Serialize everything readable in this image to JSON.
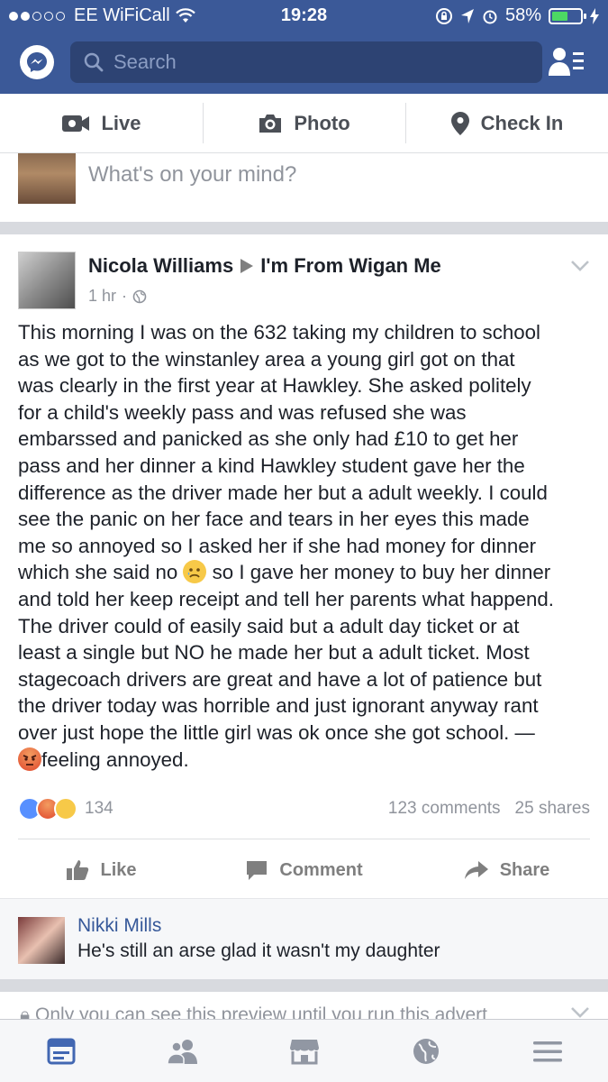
{
  "status_bar": {
    "carrier": "EE WiFiCall",
    "time": "19:28",
    "battery_percent": "58%",
    "battery_level": 0.58
  },
  "search": {
    "placeholder": "Search"
  },
  "composer": {
    "actions": [
      {
        "label": "Live",
        "icon": "video-camera-icon"
      },
      {
        "label": "Photo",
        "icon": "camera-icon"
      },
      {
        "label": "Check In",
        "icon": "location-pin-icon"
      }
    ],
    "placeholder": "What's on your mind?"
  },
  "post": {
    "author": "Nicola Williams",
    "group": "I'm From Wigan Me",
    "time": "1 hr",
    "privacy_icon": "globe-icon",
    "body_part1": "This morning I was on the 632 taking my children to school\nas we got to the winstanley  area a young girl got on that\nwas clearly in the first year at Hawkley. She asked politely\nfor a child's weekly pass and was refused she was\nembarssed and panicked as she only had £10 to get her\npass and her dinner a kind Hawkley student gave her the\ndifference as the driver made her but a adult weekly. I could\nsee the panic on her face and tears in her eyes this made\nme so annoyed so I asked her if she had money for dinner\nwhich she said no ",
    "body_part2": " so I gave her money to buy her dinner\nand told her keep receipt and tell her parents what happend.\nThe driver could of  easily said but a adult day ticket or at\nleast a single but NO he made her but a adult ticket. Most\nstagecoach drivers are great and have a lot of patience but\nthe driver today was horrible and just ignorant anyway rant\nover just hope the little girl was ok once she got school. —\n",
    "feeling": "feeling annoyed.",
    "reaction_count": "134",
    "comments_count": "123 comments",
    "shares_count": "25 shares",
    "actions": {
      "like": "Like",
      "comment": "Comment",
      "share": "Share"
    }
  },
  "comment": {
    "author": "Nikki Mills",
    "text": "He's still an arse glad it wasn't my daughter"
  },
  "next_item": {
    "text": "Only you can see this preview until you run this advert"
  },
  "tab_bar": {
    "tabs": [
      "news-feed-icon",
      "friends-icon",
      "marketplace-icon",
      "notifications-globe-icon",
      "menu-icon"
    ],
    "active_color": "#4267b2",
    "inactive_color": "#9197a3"
  },
  "colors": {
    "brand_blue": "#3b5998",
    "link_blue": "#365899"
  }
}
